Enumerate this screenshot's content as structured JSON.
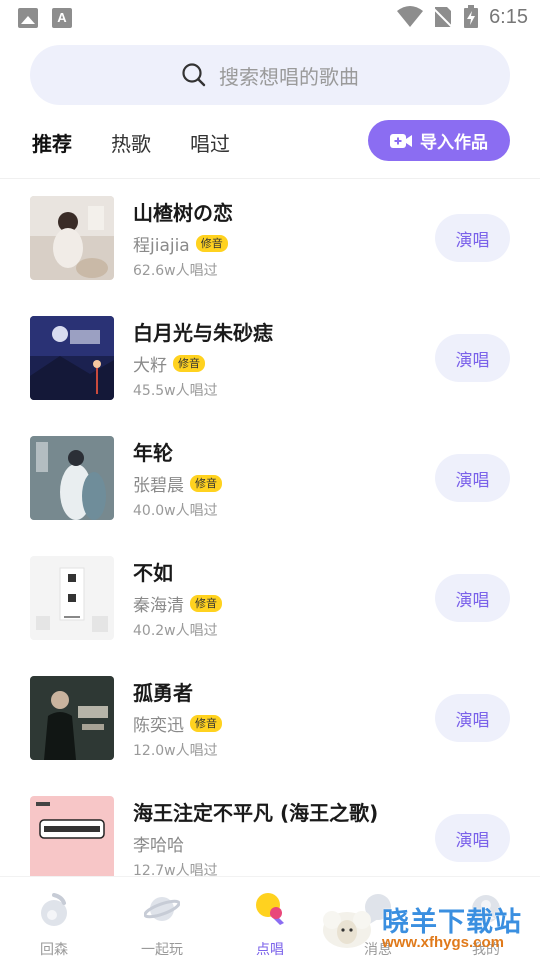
{
  "status_bar": {
    "time": "6:15"
  },
  "search": {
    "placeholder": "搜索想唱的歌曲"
  },
  "tabs": [
    {
      "label": "推荐",
      "active": true
    },
    {
      "label": "热歌",
      "active": false
    },
    {
      "label": "唱过",
      "active": false
    }
  ],
  "import_button": {
    "label": "导入作品"
  },
  "songs": [
    {
      "title": "山楂树の恋",
      "artist": "程jiajia",
      "badge": "修音",
      "count": "62.6w人唱过",
      "sing_label": "演唱"
    },
    {
      "title": "白月光与朱砂痣",
      "artist": "大籽",
      "badge": "修音",
      "count": "45.5w人唱过",
      "sing_label": "演唱"
    },
    {
      "title": "年轮",
      "artist": "张碧晨",
      "badge": "修音",
      "count": "40.0w人唱过",
      "sing_label": "演唱"
    },
    {
      "title": "不如",
      "artist": "秦海清",
      "badge": "修音",
      "count": "40.2w人唱过",
      "sing_label": "演唱"
    },
    {
      "title": "孤勇者",
      "artist": "陈奕迅",
      "badge": "修音",
      "count": "12.0w人唱过",
      "sing_label": "演唱"
    },
    {
      "title": "海王注定不平凡 (海王之歌)",
      "artist": "李哈哈",
      "badge": "",
      "count": "12.7w人唱过",
      "sing_label": "演唱"
    }
  ],
  "bottom_nav": [
    {
      "label": "回森",
      "icon": "music-note-icon",
      "active": false
    },
    {
      "label": "一起玩",
      "icon": "planet-icon",
      "active": false
    },
    {
      "label": "点唱",
      "icon": "microphone-icon",
      "active": true
    },
    {
      "label": "消息",
      "icon": "message-icon",
      "active": false
    },
    {
      "label": "我的",
      "icon": "profile-icon",
      "active": false
    }
  ],
  "watermark": {
    "text": "晓羊下载站",
    "url": "www.xfhygs.com"
  },
  "colors": {
    "accent": "#8b6df2",
    "badge": "#ffd21f",
    "search_bg": "#eef0fb"
  }
}
